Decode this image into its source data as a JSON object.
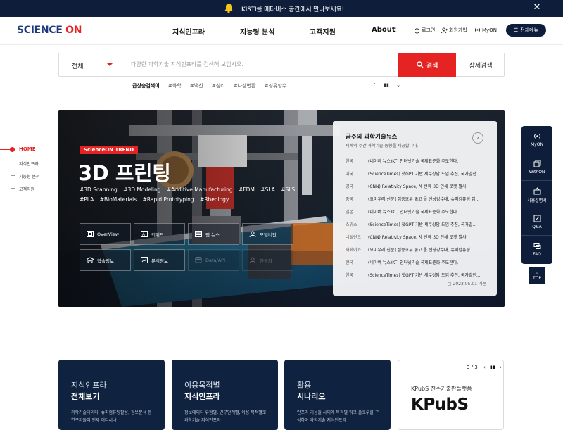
{
  "topbar": {
    "message": "KISTI를 메타버스 공간에서 만나보세요!",
    "close_icon": "close-icon",
    "bell_icon": "bell-icon"
  },
  "header": {
    "logo_text": "SCIENCE",
    "logo_on": "ON",
    "nav": [
      "지식인프라",
      "지능형 분석",
      "고객지원",
      "About"
    ],
    "util": {
      "login": "로그인",
      "join": "회원가입",
      "myon": "MyON"
    },
    "all_menu": "전체메뉴"
  },
  "search": {
    "category": "전체",
    "placeholder": "다양한 과학기술 지식인프라를 검색해 보십시오.",
    "button": "검색",
    "detail": "상세검색",
    "trend_label": "급상승검색어",
    "trend_keywords": [
      "#화학",
      "#백신",
      "#심리",
      "#나셀변환",
      "#성유향수"
    ]
  },
  "side_nav": [
    "HOME",
    "지식인프라",
    "지능형 분석",
    "고객지원"
  ],
  "hero": {
    "badge": "ScienceON TREND",
    "title": "3D 프린팅",
    "tags": [
      "#3D Scanning",
      "#3D Modeling",
      "#Additive Manufacturing",
      "#FDM",
      "#SLA",
      "#SLS",
      "#PLA",
      "#BioMaterials",
      "#Rapid Prototyping",
      "#Rheology"
    ],
    "quick": [
      "OverView",
      "키워드",
      "웹 뉴스",
      "모빌니안",
      "학술정보",
      "분석정보",
      "Data/API",
      "연구자"
    ]
  },
  "news": {
    "title": "금주의 과학기술뉴스",
    "subtitle": "세계의 주간 과학기술 동향을 제공합니다.",
    "items": [
      {
        "country": "한국",
        "text": "(네이버 뉴스)KT, 인터넷기술 국제표준화 주도한다."
      },
      {
        "country": "미국",
        "text": "(ScienceTimes) 챗GPT 기반 세무상담 도입 추진, 국가발전..."
      },
      {
        "country": "영국",
        "text": "(CNN) Relativity Space, 세 번째 3D 인쇄 로켓 발사"
      },
      {
        "country": "중국",
        "text": "(요미우리 신문) 집중호우 뚫고 올 선상강수대, 슈퍼컴퓨팅 집..."
      },
      {
        "country": "일본",
        "text": "(네이버 뉴스)KT, 인터넷기술 국제표준화 주도한다."
      },
      {
        "country": "스위스",
        "text": "(ScienceTimes) 챗GPT 기반 세무상담 도입 추진, 국가발..."
      },
      {
        "country": "네덜란드",
        "text": "(CNN) Relativity Space, 세 번째 3D 인쇄 로켓 발사"
      },
      {
        "country": "자메이카",
        "text": "(요미우리 신문) 집중호우 뚫고 올 선상강수대, 슈퍼컴퓨팅..."
      },
      {
        "country": "한국",
        "text": "(네이버 뉴스)KT, 인터넷기술 국제표준화 주도한다."
      },
      {
        "country": "한국",
        "text": "(ScienceTimes) 챗GPT 기반 세무상담 도입 추진, 국가발전..."
      }
    ],
    "date": "2023.05.01 기준"
  },
  "right_side": [
    "MyON",
    "WithON",
    "사용설명서",
    "Q&A",
    "FAQ"
  ],
  "top_button": "TOP",
  "cards": [
    {
      "line1": "지식인프라",
      "line2": "전체보기",
      "desc": "과학기술데이터, 슈퍼컴퓨팅활용, 정보분석 등 연구자들이 언제 어디서나"
    },
    {
      "line1": "이용목적별",
      "line2": "지식인프라",
      "desc": "정보데이터 유형별, 연구단계별, 이용 목적별로 과학기술 지식인프라"
    },
    {
      "line1": "활용",
      "line2": "시나리오",
      "desc": "인프라 기능들 사이에 목적별 워크 플로우를 구성하여 과학기술 지식인프라"
    }
  ],
  "kpubs": {
    "page": "3 / 3",
    "subtitle": "KPubS 전주기출판플랫폼",
    "title": "KPubS"
  }
}
